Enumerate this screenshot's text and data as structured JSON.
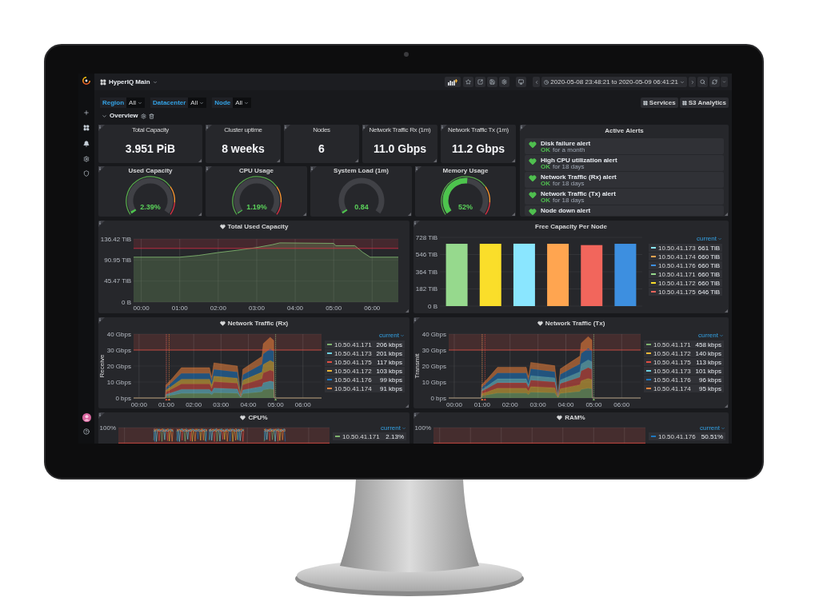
{
  "dashboard": {
    "title": "HyperIQ Main"
  },
  "time_range": {
    "text": "2020-05-08 23:48:21 to 2020-05-09 06:41:21"
  },
  "variables": [
    {
      "label": "Region",
      "value": "All"
    },
    {
      "label": "Datacenter",
      "value": "All"
    },
    {
      "label": "Node",
      "value": "All"
    }
  ],
  "links": [
    {
      "label": "Services"
    },
    {
      "label": "S3 Analytics"
    }
  ],
  "row": {
    "title": "Overview",
    "expanded": true
  },
  "stats": [
    {
      "title": "Total Capacity",
      "value": "3.951 PiB"
    },
    {
      "title": "Cluster uptime",
      "value": "8 weeks"
    },
    {
      "title": "Nodes",
      "value": "6"
    },
    {
      "title": "Network Traffic Rx (1m)",
      "value": "11.0 Gbps"
    },
    {
      "title": "Network Traffic Tx (1m)",
      "value": "11.2 Gbps"
    }
  ],
  "gauges": [
    {
      "title": "Used Capacity",
      "value": "2.39%",
      "level": 0.0239,
      "show_thresholds": true
    },
    {
      "title": "CPU Usage",
      "value": "1.19%",
      "level": 0.0119,
      "show_thresholds": true
    },
    {
      "title": "System Load (1m)",
      "value": "0.84",
      "level": 0.02,
      "show_thresholds": false
    },
    {
      "title": "Memory Usage",
      "value": "52%",
      "level": 0.52,
      "show_thresholds": true
    }
  ],
  "alerts": {
    "title": "Active Alerts",
    "items": [
      {
        "name": "Disk failure alert",
        "state": "OK",
        "duration": "for a month"
      },
      {
        "name": "High CPU utilization alert",
        "state": "OK",
        "duration": "for 18 days"
      },
      {
        "name": "Network Traffic (Rx) alert",
        "state": "OK",
        "duration": "for 18 days"
      },
      {
        "name": "Network Traffic (Tx) alert",
        "state": "OK",
        "duration": "for 18 days"
      },
      {
        "name": "Node down alert"
      }
    ]
  },
  "charts": [
    {
      "title": "Total Used Capacity",
      "alert": true,
      "chart_data": {
        "type": "area",
        "grid": true,
        "x": [
          -0.2,
          1.0,
          1.5,
          2.0,
          2.5,
          3.0,
          3.4,
          3.6,
          5.0,
          5.05,
          5.55,
          5.75,
          5.95,
          6.68
        ],
        "series": [
          {
            "color": "#7eb26d",
            "values": [
              97,
              97,
              101,
              107,
              112,
              118,
              124,
              128,
              127,
              122,
              122,
              108,
              97,
              97
            ]
          }
        ],
        "xlim": [
          -0.2,
          6.68
        ],
        "ylim": [
          0,
          136.42
        ],
        "xticks": [
          {
            "value": 0,
            "label": "00:00"
          },
          {
            "value": 1,
            "label": "01:00"
          },
          {
            "value": 2,
            "label": "02:00"
          },
          {
            "value": 3,
            "label": "03:00"
          },
          {
            "value": 4,
            "label": "04:00"
          },
          {
            "value": 5,
            "label": "05:00"
          },
          {
            "value": 6,
            "label": "06:00"
          }
        ],
        "yticks": [
          {
            "value": 0,
            "label": "0 B"
          },
          {
            "value": 45.47,
            "label": "45.47 TiB"
          },
          {
            "value": 90.95,
            "label": "90.95 TiB"
          },
          {
            "value": 136.42,
            "label": "136.42 TiB"
          }
        ],
        "ref_lines": [
          {
            "axis": "y",
            "value": 116,
            "color": "#e02f44"
          }
        ],
        "bands": [
          {
            "axis": "y",
            "from": 116,
            "to": 136.42,
            "color": "#e02f44"
          }
        ]
      }
    },
    {
      "title": "Free Capacity Per Node",
      "alert": false,
      "chart_data": {
        "type": "bar",
        "grid": true,
        "series": [
          {
            "color": "#96d98d",
            "values": [
              660
            ]
          },
          {
            "color": "#fade2a",
            "values": [
              660
            ]
          },
          {
            "color": "#8ae6ff",
            "values": [
              661
            ]
          },
          {
            "color": "#ffa550",
            "values": [
              660
            ]
          },
          {
            "color": "#f2665c",
            "values": [
              646
            ]
          },
          {
            "color": "#3d8fe0",
            "values": [
              660
            ]
          }
        ],
        "ylim": [
          0,
          728
        ],
        "yticks": [
          {
            "value": 0,
            "label": "0 B"
          },
          {
            "value": 182,
            "label": "182 TiB"
          },
          {
            "value": 364,
            "label": "364 TiB"
          },
          {
            "value": 546,
            "label": "546 TiB"
          },
          {
            "value": 728,
            "label": "728 TiB"
          }
        ]
      },
      "legend": {
        "header": "current",
        "items": [
          {
            "name": "10.50.41.173",
            "value": "661 TiB",
            "color": "#8ae6ff"
          },
          {
            "name": "10.50.41.174",
            "value": "660 TiB",
            "color": "#ffa550"
          },
          {
            "name": "10.50.41.176",
            "value": "660 TiB",
            "color": "#3d8fe0"
          },
          {
            "name": "10.50.41.171",
            "value": "660 TiB",
            "color": "#96d98d"
          },
          {
            "name": "10.50.41.172",
            "value": "660 TiB",
            "color": "#fade2a"
          },
          {
            "name": "10.50.41.175",
            "value": "646 TiB",
            "color": "#f2665c"
          }
        ]
      }
    },
    {
      "title": "Network Traffic (Rx)",
      "alert": true,
      "chart_data": {
        "type": "area",
        "stacked": true,
        "grid": true,
        "ylabel": "Receive",
        "x": [
          -0.2,
          0.97,
          0.98,
          1.2,
          1.4,
          1.55,
          2.58,
          2.66,
          2.74,
          3.6,
          3.72,
          3.8,
          4.5,
          4.55,
          4.8,
          4.93,
          4.95,
          6.68
        ],
        "series": [
          {
            "color": "#7eb26d",
            "values": [
              0,
              0,
              1.2,
              1.8,
              2.4,
              2.9,
              2.9,
              2,
              3.3,
              3,
              0.3,
              2.7,
              3.9,
              5.1,
              5.7,
              5.4,
              0,
              0
            ]
          },
          {
            "color": "#6ed0e0",
            "values": [
              0,
              0,
              1,
              1.6,
              2.1,
              2.5,
              2.5,
              1.7,
              2.9,
              2.6,
              0.3,
              2.3,
              3.4,
              4.4,
              4.9,
              4.7,
              0,
              0
            ]
          },
          {
            "color": "#e24d42",
            "values": [
              0,
              0,
              1.4,
              2.2,
              2.9,
              3.4,
              3.4,
              2.3,
              4,
              3.6,
              0.4,
              3.2,
              4.7,
              6.1,
              6.8,
              6.5,
              0,
              0
            ]
          },
          {
            "color": "#eab839",
            "values": [
              0,
              0,
              1.3,
              1.9,
              2.6,
              3,
              3,
              2.1,
              3.5,
              3.2,
              0.3,
              2.9,
              4.2,
              5.4,
              6.1,
              5.8,
              0,
              0
            ]
          },
          {
            "color": "#1f78c1",
            "values": [
              0,
              0,
              1.5,
              2.3,
              3,
              3.6,
              3.6,
              2.5,
              4.2,
              3.8,
              0.4,
              3.4,
              4.9,
              6.5,
              7.2,
              6.8,
              0,
              0
            ]
          },
          {
            "color": "#ef843c",
            "values": [
              0,
              0,
              1.6,
              2.2,
              3,
              3.6,
              3.6,
              2.4,
              4.1,
              3.8,
              0.3,
              3.5,
              4.9,
              6.5,
              7.3,
              6.8,
              0,
              0
            ]
          }
        ],
        "xlim": [
          -0.2,
          6.68
        ],
        "ylim": [
          0,
          40
        ],
        "xticks": [
          {
            "value": 0,
            "label": "00:00"
          },
          {
            "value": 1,
            "label": "01:00"
          },
          {
            "value": 2,
            "label": "02:00"
          },
          {
            "value": 3,
            "label": "03:00"
          },
          {
            "value": 4,
            "label": "04:00"
          },
          {
            "value": 5,
            "label": "05:00"
          },
          {
            "value": 6,
            "label": "06:00"
          }
        ],
        "yticks": [
          {
            "value": 0,
            "label": "0 bps"
          },
          {
            "value": 10,
            "label": "10 Gbps"
          },
          {
            "value": 20,
            "label": "20 Gbps"
          },
          {
            "value": 30,
            "label": "30 Gbps"
          },
          {
            "value": 40,
            "label": "40 Gbps"
          }
        ],
        "ref_lines": [
          {
            "axis": "y",
            "value": 30,
            "color": "#e24d42"
          },
          {
            "axis": "x",
            "value": 1.0,
            "color": "#e24d42"
          },
          {
            "axis": "x",
            "value": 1.1,
            "color": "#ef843c"
          },
          {
            "axis": "x",
            "value": 5.0,
            "color": "#7eb26d"
          }
        ],
        "bands": [
          {
            "axis": "y",
            "from": 30,
            "to": 40,
            "color": "#e24d42"
          }
        ]
      },
      "legend": {
        "header": "current",
        "items": [
          {
            "name": "10.50.41.171",
            "value": "206 kbps",
            "color": "#7eb26d"
          },
          {
            "name": "10.50.41.173",
            "value": "201 kbps",
            "color": "#6ed0e0"
          },
          {
            "name": "10.50.41.175",
            "value": "117 kbps",
            "color": "#e24d42"
          },
          {
            "name": "10.50.41.172",
            "value": "103 kbps",
            "color": "#eab839"
          },
          {
            "name": "10.50.41.176",
            "value": "99 kbps",
            "color": "#1f78c1"
          },
          {
            "name": "10.50.41.174",
            "value": "91 kbps",
            "color": "#ef843c"
          }
        ]
      }
    },
    {
      "title": "Network Traffic (Tx)",
      "alert": true,
      "chart_data": {
        "type": "area",
        "stacked": true,
        "grid": true,
        "ylabel": "Transmit",
        "x": [
          -0.2,
          0.97,
          0.98,
          1.2,
          1.4,
          1.55,
          2.58,
          2.66,
          2.74,
          3.6,
          3.72,
          3.8,
          4.5,
          4.55,
          4.8,
          4.93,
          4.95,
          6.68
        ],
        "series": [
          {
            "color": "#7eb26d",
            "values": [
              0,
              0,
              1.4,
              2,
              2.6,
              3.1,
              3.1,
              2.1,
              3.6,
              3.2,
              0.3,
              2.9,
              4.1,
              5.4,
              6.1,
              5.7,
              0,
              0
            ]
          },
          {
            "color": "#eab839",
            "values": [
              0,
              0,
              1.3,
              1.9,
              2.6,
              3,
              3,
              2.1,
              3.5,
              3.2,
              0.3,
              2.9,
              4.2,
              5.4,
              6.1,
              5.8,
              0,
              0
            ]
          },
          {
            "color": "#e24d42",
            "values": [
              0,
              0,
              1.4,
              2.2,
              2.9,
              3.4,
              3.4,
              2.3,
              4,
              3.6,
              0.4,
              3.2,
              4.7,
              6.1,
              6.8,
              6.5,
              0,
              0
            ]
          },
          {
            "color": "#6ed0e0",
            "values": [
              0,
              0,
              1,
              1.6,
              2.1,
              2.5,
              2.5,
              1.7,
              2.9,
              2.6,
              0.3,
              2.3,
              3.4,
              4.4,
              4.9,
              4.7,
              0,
              0
            ]
          },
          {
            "color": "#1f78c1",
            "values": [
              0,
              0,
              1.5,
              2.3,
              3,
              3.6,
              3.6,
              2.5,
              4.2,
              3.8,
              0.4,
              3.4,
              4.9,
              6.5,
              7.2,
              6.8,
              0,
              0
            ]
          },
          {
            "color": "#ef843c",
            "values": [
              0,
              0,
              1.6,
              2.2,
              3,
              3.6,
              3.6,
              2.4,
              4.1,
              3.8,
              0.3,
              3.5,
              4.9,
              6.5,
              7.3,
              6.8,
              0,
              0
            ]
          }
        ],
        "xlim": [
          -0.2,
          6.68
        ],
        "ylim": [
          0,
          40
        ],
        "xticks": [
          {
            "value": 0,
            "label": "00:00"
          },
          {
            "value": 1,
            "label": "01:00"
          },
          {
            "value": 2,
            "label": "02:00"
          },
          {
            "value": 3,
            "label": "03:00"
          },
          {
            "value": 4,
            "label": "04:00"
          },
          {
            "value": 5,
            "label": "05:00"
          },
          {
            "value": 6,
            "label": "06:00"
          }
        ],
        "yticks": [
          {
            "value": 0,
            "label": "0 bps"
          },
          {
            "value": 10,
            "label": "10 Gbps"
          },
          {
            "value": 20,
            "label": "20 Gbps"
          },
          {
            "value": 30,
            "label": "30 Gbps"
          },
          {
            "value": 40,
            "label": "40 Gbps"
          }
        ],
        "ref_lines": [
          {
            "axis": "y",
            "value": 30,
            "color": "#e24d42"
          },
          {
            "axis": "x",
            "value": 1.0,
            "color": "#ef843c"
          },
          {
            "axis": "x",
            "value": 1.1,
            "color": "#e24d42"
          },
          {
            "axis": "x",
            "value": 5.0,
            "color": "#7eb26d"
          }
        ],
        "bands": [
          {
            "axis": "y",
            "from": 30,
            "to": 40,
            "color": "#e24d42"
          }
        ]
      },
      "legend": {
        "header": "current",
        "items": [
          {
            "name": "10.50.41.171",
            "value": "458 kbps",
            "color": "#7eb26d"
          },
          {
            "name": "10.50.41.172",
            "value": "140 kbps",
            "color": "#eab839"
          },
          {
            "name": "10.50.41.175",
            "value": "113 kbps",
            "color": "#e24d42"
          },
          {
            "name": "10.50.41.173",
            "value": "101 kbps",
            "color": "#6ed0e0"
          },
          {
            "name": "10.50.41.176",
            "value": "96 kbps",
            "color": "#1f78c1"
          },
          {
            "name": "10.50.41.174",
            "value": "95 kbps",
            "color": "#ef843c"
          }
        ]
      }
    }
  ],
  "bottom_panels": [
    {
      "title": "CPU%",
      "alert": true,
      "kind": "spiky",
      "y_tick": "100%",
      "legend": {
        "header": "current",
        "items": [
          {
            "name": "10.50.41.171",
            "value": "2.13%",
            "color": "#7eb26d"
          }
        ]
      }
    },
    {
      "title": "RAM%",
      "alert": true,
      "kind": "plain",
      "y_tick": "100%",
      "legend": {
        "header": "current",
        "items": [
          {
            "name": "10.50.41.176",
            "value": "50.51%",
            "color": "#1f78c1"
          }
        ]
      }
    }
  ]
}
